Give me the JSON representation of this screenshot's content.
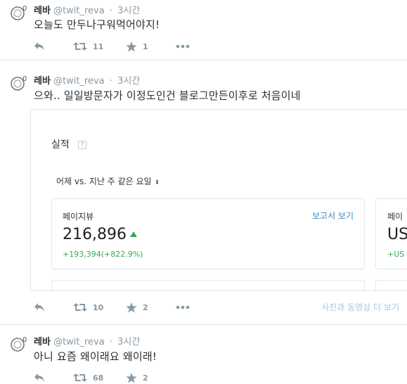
{
  "tweets": [
    {
      "name": "레바",
      "handle": "@twit_reva",
      "separator": "·",
      "time": "3시간",
      "text": "오늘도 만두나구워먹어야지!",
      "retweets": "11",
      "favorites": "1"
    },
    {
      "name": "레바",
      "handle": "@twit_reva",
      "separator": "·",
      "time": "3시간",
      "text": "으와.. 일일방문자가 이정도인건 블로그만든이후로 처음이네",
      "retweets": "10",
      "favorites": "2",
      "media_link": "사진과 동영상 더 보기",
      "card": {
        "title": "실적",
        "help": "?",
        "period": "어제 vs. 지난 주 같은 요일",
        "period_caret": "⬍",
        "metric": {
          "label": "페이지뷰",
          "link": "보고서 보기",
          "value": "216,896",
          "change": "+193,394(+822.9%)"
        },
        "metric2": {
          "label": "페이",
          "value": "US",
          "change": "+US"
        }
      }
    },
    {
      "name": "레바",
      "handle": "@twit_reva",
      "separator": "·",
      "time": "3시간",
      "text": "아니 요즘 왜이래요 왜이래!",
      "retweets": "68",
      "favorites": "2"
    }
  ],
  "icons": {
    "reply": "reply-icon",
    "retweet": "retweet-icon",
    "favorite": "star-icon",
    "more": "more-icon"
  },
  "colors": {
    "action_gray": "#8899a6",
    "link_blue": "#3b88c3",
    "increase_green": "#3aa757"
  }
}
